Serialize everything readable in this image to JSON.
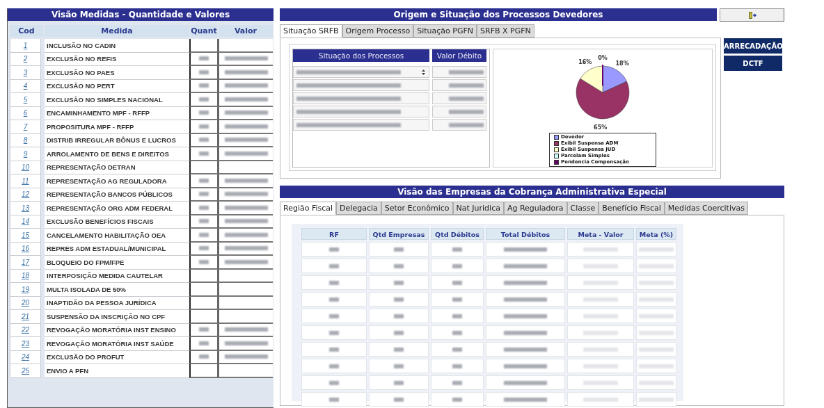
{
  "medidas_panel": {
    "title": "Visão Medidas - Quantidade e Valores",
    "columns": [
      "Cod",
      "Medida",
      "Quant",
      "Valor"
    ],
    "rows": [
      {
        "cod": "1",
        "medida": "INCLUSÃO NO CADIN",
        "redacted": false
      },
      {
        "cod": "2",
        "medida": "EXCLUSÃO NO REFIS",
        "redacted": true
      },
      {
        "cod": "3",
        "medida": "EXCLUSÃO NO PAES",
        "redacted": true
      },
      {
        "cod": "4",
        "medida": "EXCLUSÃO NO PERT",
        "redacted": true
      },
      {
        "cod": "5",
        "medida": "EXCLUSÃO NO SIMPLES NACIONAL",
        "redacted": true
      },
      {
        "cod": "6",
        "medida": "ENCAMINHAMENTO MPF - RFFP",
        "redacted": true
      },
      {
        "cod": "7",
        "medida": "PROPOSITURA MPF - RFFP",
        "redacted": true
      },
      {
        "cod": "8",
        "medida": "DISTRIB  IRREGULAR BÔNUS E LUCROS",
        "redacted": true
      },
      {
        "cod": "9",
        "medida": "ARROLAMENTO DE BENS E DIREITOS",
        "redacted": true
      },
      {
        "cod": "10",
        "medida": "REPRESENTAÇÃO DETRAN",
        "redacted": false
      },
      {
        "cod": "11",
        "medida": "REPRESENTAÇÃO AG REGULADORA",
        "redacted": true
      },
      {
        "cod": "12",
        "medida": "REPRESENTAÇÃO BANCOS PÚBLICOS",
        "redacted": true
      },
      {
        "cod": "13",
        "medida": "REPRESENTAÇÃO ORG ADM FEDERAL",
        "redacted": true
      },
      {
        "cod": "14",
        "medida": "EXCLUSÃO BENEFÍCIOS FISCAIS",
        "redacted": true
      },
      {
        "cod": "15",
        "medida": "CANCELAMENTO HABILITAÇÃO OEA",
        "redacted": true
      },
      {
        "cod": "16",
        "medida": "REPRES ADM ESTADUAL/MUNICIPAL",
        "redacted": true
      },
      {
        "cod": "17",
        "medida": "BLOQUEIO DO FPM/FPE",
        "redacted": true
      },
      {
        "cod": "18",
        "medida": "INTERPOSIÇÃO MEDIDA CAUTELAR",
        "redacted": false
      },
      {
        "cod": "19",
        "medida": "MULTA ISOLADA DE 50%",
        "redacted": false
      },
      {
        "cod": "20",
        "medida": "INAPTIDÃO DA PESSOA JURÍDICA",
        "redacted": false
      },
      {
        "cod": "21",
        "medida": "SUSPENSÃO DA INSCRIÇÃO NO CPF",
        "redacted": false
      },
      {
        "cod": "22",
        "medida": "REVOGAÇÃO MORATÓRIA INST ENSINO",
        "redacted": true
      },
      {
        "cod": "23",
        "medida": "REVOGAÇÃO  MORATÓRIA  INST SAÚDE",
        "redacted": true
      },
      {
        "cod": "24",
        "medida": "EXCLUSÃO  DO PROFUT",
        "redacted": true
      },
      {
        "cod": "25",
        "medida": "ENVIO A PFN",
        "redacted": false
      }
    ]
  },
  "processos_panel": {
    "title": "Origem e Situação dos Processos Devedores",
    "tabs": [
      {
        "label": "Situação SRFB",
        "selected": true
      },
      {
        "label": "Origem Processo",
        "selected": false
      },
      {
        "label": "Situação PGFN",
        "selected": false
      },
      {
        "label": "SRFB X PGFN",
        "selected": false
      }
    ],
    "situacao_table": {
      "columns": [
        "Situação dos Processos",
        "Valor Débito"
      ],
      "rows": [
        {
          "redacted": true
        },
        {
          "redacted": true
        },
        {
          "redacted": true
        },
        {
          "redacted": true
        },
        {
          "redacted": true
        }
      ]
    },
    "chart_data": {
      "type": "pie",
      "categories": [
        "Devedor",
        "Exibil Suspensa ADM",
        "Exibil Suspensa JUD",
        "Parcelam Simples",
        "Pendencia Compensação"
      ],
      "values": [
        18,
        65,
        16,
        null,
        0
      ],
      "data_labels": true,
      "value_labels": [
        "18%",
        "65%",
        "16%",
        null,
        "0%"
      ]
    },
    "legend": [
      {
        "color": "#9999ff"
      },
      {
        "color": "#993366"
      },
      {
        "color": "#ffffcc"
      },
      {
        "color": "#ccffff"
      },
      {
        "color": "#660066"
      }
    ]
  },
  "side_buttons": [
    "ARRECADAÇÃO",
    "DCTF"
  ],
  "empresas_panel": {
    "title": "Visão das Empresas da Cobrança Administrativa Especial",
    "tabs": [
      {
        "label": "Região Fiscal",
        "selected": true
      },
      {
        "label": "Delegacia",
        "selected": false
      },
      {
        "label": "Setor Econômico",
        "selected": false
      },
      {
        "label": "Nat Juridica",
        "selected": false
      },
      {
        "label": "Ag Reguladora",
        "selected": false
      },
      {
        "label": "Classe",
        "selected": false
      },
      {
        "label": "Benefício Fiscal",
        "selected": false
      },
      {
        "label": "Medidas Coercitivas",
        "selected": false
      }
    ],
    "columns": [
      "RF",
      "Qtd Empresas",
      "Qtd Débitos",
      "Total Débitos",
      "Meta - Valor",
      "Meta (%)"
    ],
    "rows": [
      {
        "redacted": true
      },
      {
        "redacted": true
      },
      {
        "redacted": true
      },
      {
        "redacted": true
      },
      {
        "redacted": true
      },
      {
        "redacted": true
      },
      {
        "redacted": true
      },
      {
        "redacted": true
      },
      {
        "redacted": true
      },
      {
        "redacted": true
      }
    ]
  }
}
